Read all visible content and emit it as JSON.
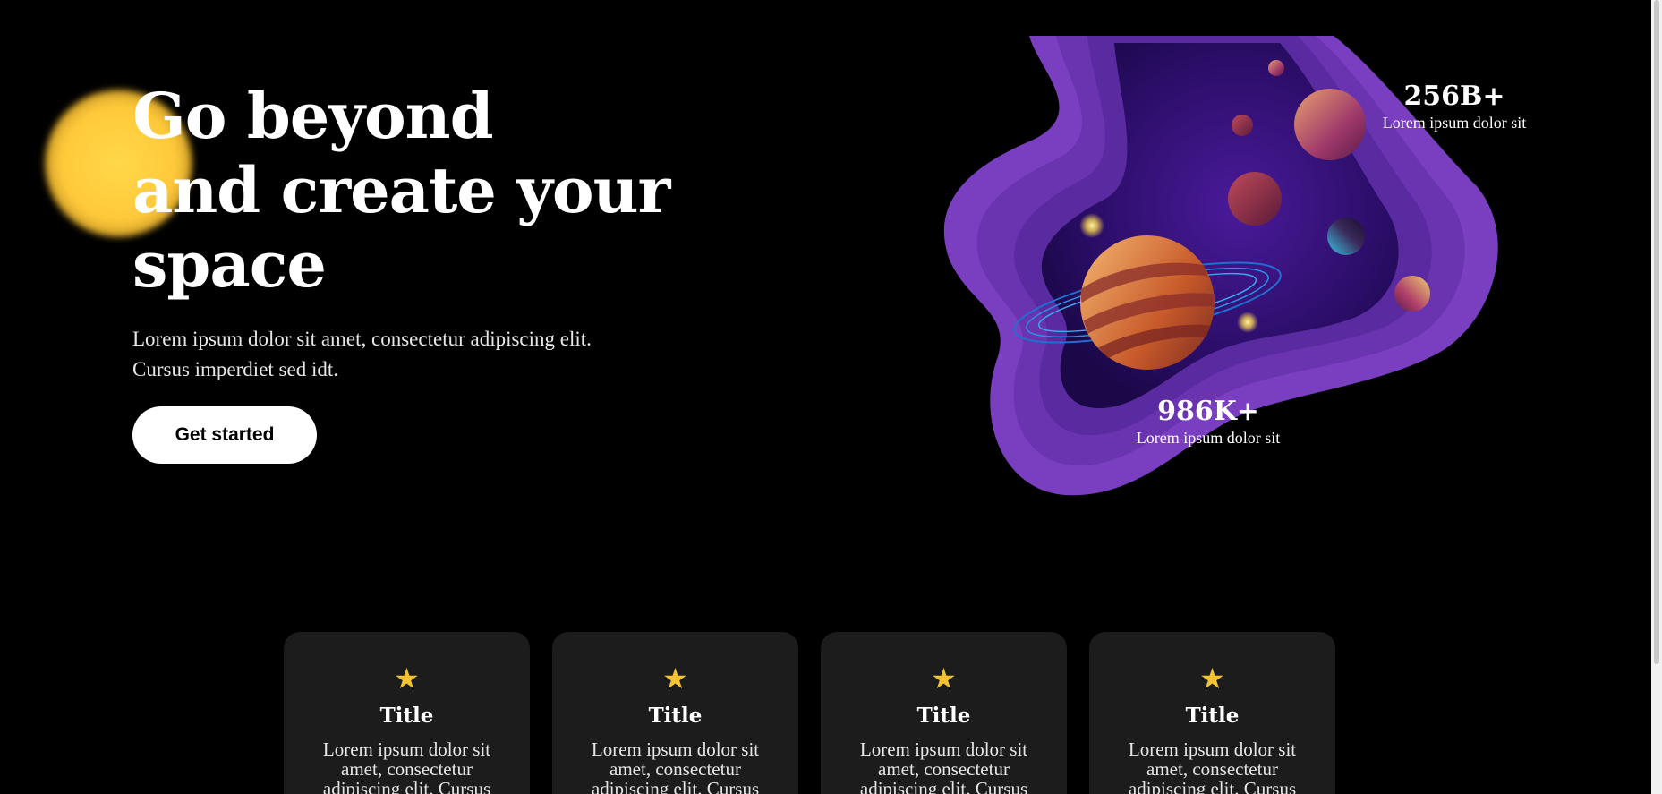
{
  "hero": {
    "title_lines": [
      "Go beyond",
      "and create your",
      "space"
    ],
    "description_lines": [
      "Lorem ipsum dolor sit amet, consectetur adipiscing elit.",
      "Cursus imperdiet sed idt."
    ],
    "cta_label": "Get started"
  },
  "stats": [
    {
      "value": "256B+",
      "label": "Lorem ipsum dolor sit"
    },
    {
      "value": "986K+",
      "label": "Lorem ipsum dolor sit"
    }
  ],
  "cards": [
    {
      "icon": "star-icon",
      "title": "Title",
      "text": "Lorem ipsum dolor sit amet, consectetur adipiscing elit. Cursus"
    },
    {
      "icon": "star-icon",
      "title": "Title",
      "text": "Lorem ipsum dolor sit amet, consectetur adipiscing elit. Cursus"
    },
    {
      "icon": "star-icon",
      "title": "Title",
      "text": "Lorem ipsum dolor sit amet, consectetur adipiscing elit. Cursus"
    },
    {
      "icon": "star-icon",
      "title": "Title",
      "text": "Lorem ipsum dolor sit amet, consectetur adipiscing elit. Cursus"
    }
  ],
  "colors": {
    "background": "#000000",
    "card_background": "#1c1c1c",
    "accent_purple": "#7a3fc0",
    "sun_yellow": "#ffd84a",
    "star_yellow": "#f2c230"
  }
}
